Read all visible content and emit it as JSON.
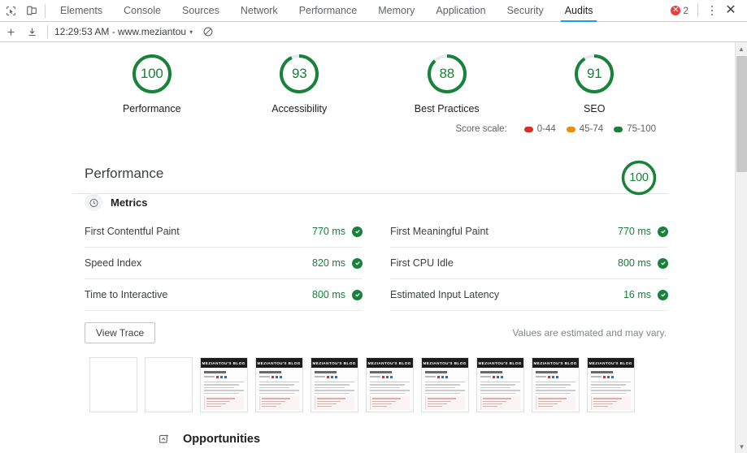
{
  "devtools": {
    "toolbar_icons": [
      {
        "name": "inspect-element-icon",
        "label": "Inspect element"
      },
      {
        "name": "device-toolbar-icon",
        "label": "Toggle device toolbar"
      }
    ],
    "tabs": [
      {
        "label": "Elements",
        "selected": false
      },
      {
        "label": "Console",
        "selected": false
      },
      {
        "label": "Sources",
        "selected": false
      },
      {
        "label": "Network",
        "selected": false
      },
      {
        "label": "Performance",
        "selected": false
      },
      {
        "label": "Memory",
        "selected": false
      },
      {
        "label": "Application",
        "selected": false
      },
      {
        "label": "Security",
        "selected": false
      },
      {
        "label": "Audits",
        "selected": true
      }
    ],
    "error_count": "2",
    "more_options_label": "Customize and control DevTools",
    "close_label": "Close DevTools",
    "accent_color": "#1a9cf0",
    "error_color": "#ec3d3d"
  },
  "audits_toolbar": {
    "add_label": "Perform an audit",
    "export_label": "Export report",
    "run_select_value": "12:29:53 AM - www.meziantou",
    "caret": "▾",
    "clear_label": "Clear all"
  },
  "report": {
    "gauges": [
      {
        "score": "100",
        "label": "Performance",
        "value": 100
      },
      {
        "score": "93",
        "label": "Accessibility",
        "value": 93
      },
      {
        "score": "88",
        "label": "Best Practices",
        "value": 88
      },
      {
        "score": "91",
        "label": "SEO",
        "value": 91
      }
    ],
    "score_scale": {
      "title": "Score scale:",
      "items": [
        {
          "range": "0-44",
          "color": "#d93025"
        },
        {
          "range": "45-74",
          "color": "#e8900c"
        },
        {
          "range": "75-100",
          "color": "#178239"
        }
      ]
    },
    "performance": {
      "title": "Performance",
      "score": "100",
      "score_value": 100,
      "metrics_title": "Metrics",
      "metrics_icon": "stopwatch-icon",
      "metrics_left": [
        {
          "name": "First Contentful Paint",
          "value": "770 ms",
          "pass": true
        },
        {
          "name": "Speed Index",
          "value": "820 ms",
          "pass": true
        },
        {
          "name": "Time to Interactive",
          "value": "800 ms",
          "pass": true
        }
      ],
      "metrics_right": [
        {
          "name": "First Meaningful Paint",
          "value": "770 ms",
          "pass": true
        },
        {
          "name": "First CPU Idle",
          "value": "800 ms",
          "pass": true
        },
        {
          "name": "Estimated Input Latency",
          "value": "16 ms",
          "pass": true
        }
      ],
      "view_trace_label": "View Trace",
      "estimated_note": "Values are estimated and may vary.",
      "filmstrip": [
        {
          "blank": true,
          "brand": ""
        },
        {
          "blank": true,
          "brand": ""
        },
        {
          "blank": false,
          "brand": "MEZIANTOU'S BLOG"
        },
        {
          "blank": false,
          "brand": "MEZIANTOU'S BLOG"
        },
        {
          "blank": false,
          "brand": "MEZIANTOU'S BLOG"
        },
        {
          "blank": false,
          "brand": "MEZIANTOU'S BLOG"
        },
        {
          "blank": false,
          "brand": "MEZIANTOU'S BLOG"
        },
        {
          "blank": false,
          "brand": "MEZIANTOU'S BLOG"
        },
        {
          "blank": false,
          "brand": "MEZIANTOU'S BLOG"
        },
        {
          "blank": false,
          "brand": "MEZIANTOU'S BLOG"
        }
      ],
      "opportunities_title": "Opportunities",
      "opportunities_icon": "image-opportunity-icon"
    },
    "pass_color": "#178239"
  }
}
